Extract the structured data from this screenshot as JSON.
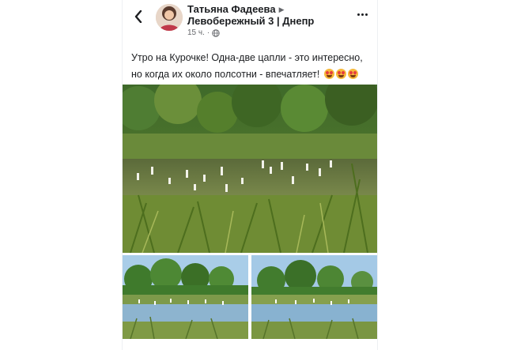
{
  "post": {
    "author": "Татьяна Фадеева",
    "group": "Левобережный 3 | Днепр",
    "time": "15 ч.",
    "separator": "·",
    "text": "Утро на Курочке! Одна-две цапли - это интересно, но когда их около полсотни - впечатляет!",
    "emoji_count": 3
  },
  "icons": {
    "back": "back-chevron-icon",
    "share_arrow": "caret-right-icon",
    "privacy": "globe-icon",
    "more": "more-options-icon",
    "emoji": "heart-eyes-emoji"
  },
  "colors": {
    "text": "#1c1e21",
    "secondary_text": "#65676b",
    "background": "#ffffff"
  }
}
